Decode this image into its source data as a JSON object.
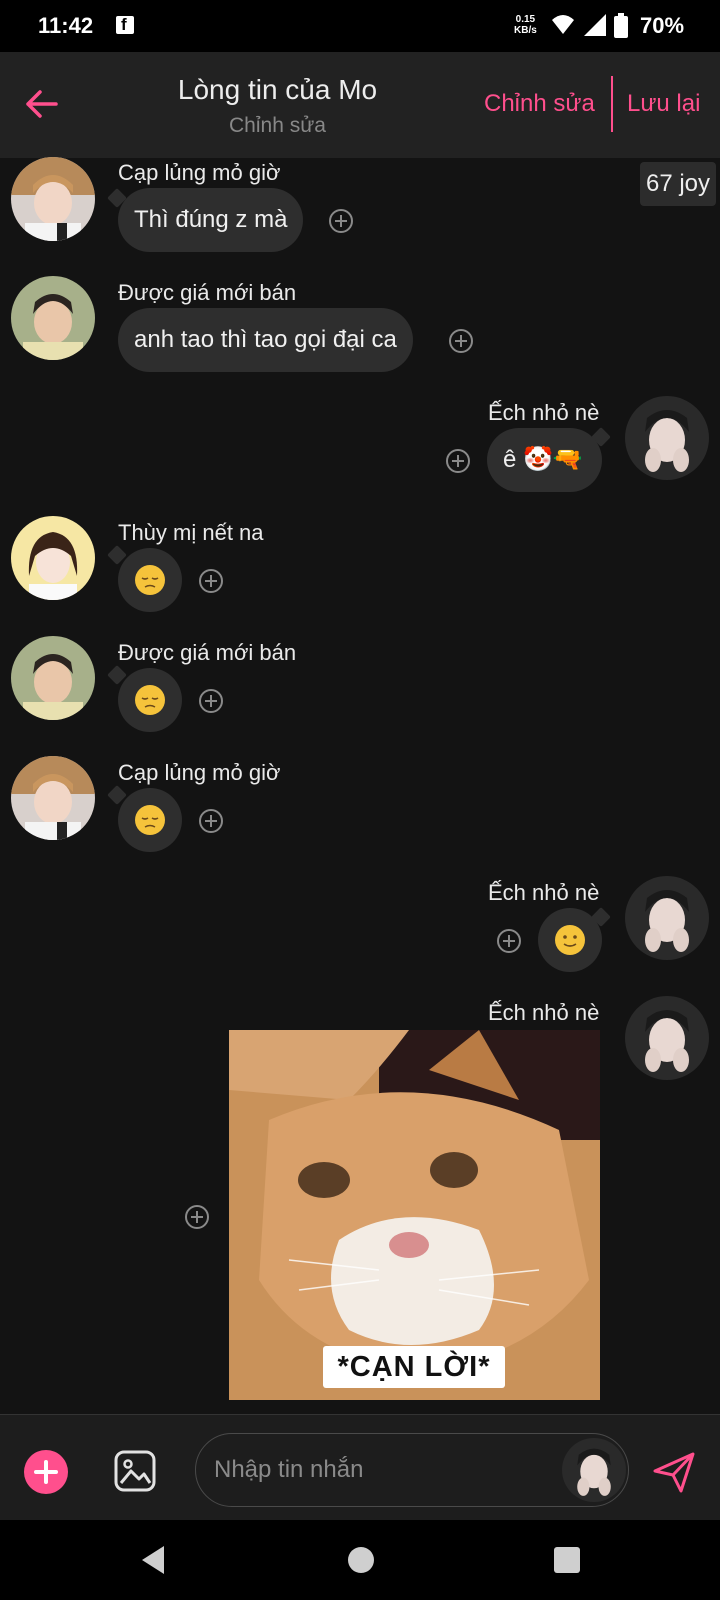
{
  "status_bar": {
    "time": "11:42",
    "net_speed_value": "0.15",
    "net_speed_unit": "KB/s",
    "battery": "70%"
  },
  "header": {
    "title": "Lòng tin của Mo",
    "subtitle": "Chỉnh sửa",
    "edit_label": "Chỉnh sửa",
    "save_label": "Lưu lại"
  },
  "joy_badge": "67 joy",
  "messages": [
    {
      "sender": "Cạp lủng mỏ giờ",
      "side": "left",
      "text": "Thì đúng z mà"
    },
    {
      "sender": "Được giá mới bán",
      "side": "left",
      "text": "anh tao thì tao gọi đại ca"
    },
    {
      "sender": "Ếch nhỏ nè",
      "side": "right",
      "text": "ê 🤡🔫"
    },
    {
      "sender": "Thùy mị nết na",
      "side": "left",
      "emoji": "pensive"
    },
    {
      "sender": "Được giá mới bán",
      "side": "left",
      "emoji": "pensive"
    },
    {
      "sender": "Cạp lủng mỏ giờ",
      "side": "left",
      "emoji": "pensive"
    },
    {
      "sender": "Ếch nhỏ nè",
      "side": "right",
      "emoji": "slight-smile"
    },
    {
      "sender": "Ếch nhỏ nè",
      "side": "right",
      "image_caption": "*CẠN LỜI*"
    }
  ],
  "input": {
    "placeholder": "Nhập tin nhắn"
  },
  "colors": {
    "accent": "#ff4f8d",
    "background": "#131313",
    "bubble": "#2e2e2e",
    "header": "#222222"
  }
}
